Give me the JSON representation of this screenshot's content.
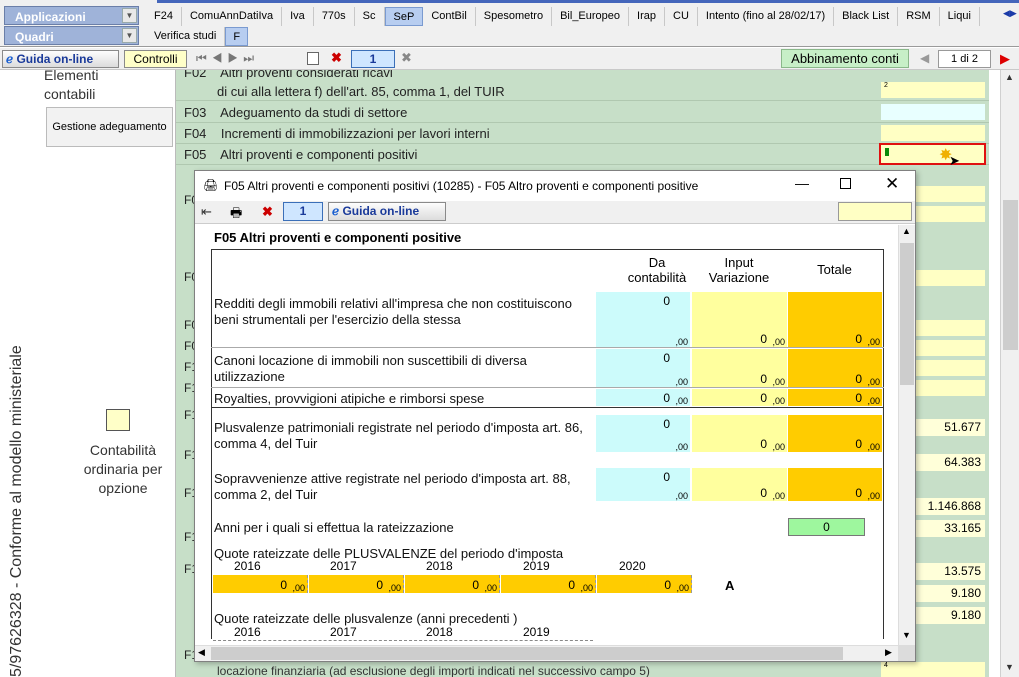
{
  "top": {
    "applicazioni": "Applicazioni",
    "quadri": "Quadri",
    "tabs": [
      "F24",
      "ComuAnnDatiIva",
      "Iva",
      "770s",
      "Sc",
      "SeP",
      "ContBil",
      "Spesometro",
      "Bil_Europeo",
      "Irap",
      "CU",
      "Intento (fino al 28/02/17)",
      "Black List",
      "RSM",
      "Liqui"
    ],
    "active_tab": "SeP",
    "subtabs": [
      "Verifica studi",
      "F"
    ]
  },
  "toolbar": {
    "guida": "Guida on-line",
    "controlli": "Controlli",
    "page_num": "1",
    "abbinamento": "Abbinamento conti",
    "page_of": "1 di 2"
  },
  "left": {
    "elementi": "Elementi contabili",
    "gestione": "Gestione adeguamento",
    "contabilita": "Contabilità ordinaria per opzione",
    "vertical": "5/97626328 - Conforme al modello ministeriale"
  },
  "form": {
    "rows": [
      {
        "code": "F02",
        "text": "Altri proventi considerati ricavi"
      },
      {
        "code": "",
        "text": "di cui alla lettera f) dell'art. 85, comma 1, del TUIR"
      },
      {
        "code": "F03",
        "text": "Adeguamento da studi di settore"
      },
      {
        "code": "F04",
        "text": "Incrementi di immobilizzazioni per lavori interni"
      },
      {
        "code": "F05",
        "text": "Altri proventi e componenti positivi"
      }
    ],
    "small2": "2",
    "small4": "4",
    "bottom_text": "locazione finanziaria (ad esclusione degli importi indicati nel successivo campo 5)",
    "partial_codes": [
      "F0",
      "F0",
      "F0",
      "F0",
      "F1",
      "F1",
      "F1",
      "F1",
      "F1",
      "F1",
      "F1",
      "F1"
    ],
    "right_values": [
      "51.677",
      "64.383",
      "1.146.868",
      "33.165",
      "13.575",
      "9.180",
      "9.180"
    ]
  },
  "dialog": {
    "title": "F05 Altri proventi e componenti positivi (10285) - F05 Altro proventi e componenti positive",
    "page_num": "1",
    "guida": "Guida on-line",
    "heading": "F05 Altri proventi e componenti positive",
    "col_da": "Da contabilità",
    "col_input": "Input Variazione",
    "col_totale": "Totale",
    "rows": [
      {
        "label": "Redditi degli immobili relativi all'impresa che non costituiscono beni strumentali per l'esercizio della stessa",
        "da": "0",
        "input": "0",
        "tot": "0"
      },
      {
        "label": "Canoni locazione di immobili non suscettibili di diversa utilizzazione",
        "da": "0",
        "input": "0",
        "tot": "0"
      },
      {
        "label": "Royalties, provvigioni atipiche e rimborsi spese",
        "da": "0",
        "input": "0",
        "tot": "0"
      },
      {
        "label": "Plusvalenze patrimoniali registrate nel periodo d'imposta art. 86, comma 4, del Tuir",
        "da": "0",
        "input": "0",
        "tot": "0"
      },
      {
        "label": "Sopravvenienze attive registrate nel periodo d'imposta art. 88, comma 2, del Tuir",
        "da": "0",
        "input": "0",
        "tot": "0"
      }
    ],
    "dec": ",00",
    "anni_label": "Anni per i quali si effettua la rateizzazione",
    "anni_value": "0",
    "quote_label": "Quote rateizzate delle PLUSVALENZE del periodo d'imposta",
    "years": [
      "2016",
      "2017",
      "2018",
      "2019",
      "2020"
    ],
    "quote_values": [
      "0",
      "0",
      "0",
      "0",
      "0"
    ],
    "a_label": "A",
    "quote_prec_label": "Quote rateizzate delle plusvalenze  (anni precedenti )",
    "years_prec": [
      "2016",
      "2017",
      "2018",
      "2019"
    ]
  }
}
